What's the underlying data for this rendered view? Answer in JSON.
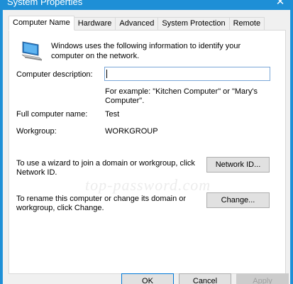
{
  "window": {
    "title": "System Properties",
    "close_glyph": "✕"
  },
  "tabs": [
    {
      "label": "Computer Name",
      "active": true
    },
    {
      "label": "Hardware",
      "active": false
    },
    {
      "label": "Advanced",
      "active": false
    },
    {
      "label": "System Protection",
      "active": false
    },
    {
      "label": "Remote",
      "active": false
    }
  ],
  "panel": {
    "intro": "Windows uses the following information to identify your computer on the network.",
    "computer_description": {
      "label": "Computer description:",
      "value": "",
      "example": "For example: \"Kitchen Computer\" or \"Mary's Computer\"."
    },
    "full_computer_name": {
      "label": "Full computer name:",
      "value": "Test"
    },
    "workgroup": {
      "label": "Workgroup:",
      "value": "WORKGROUP"
    },
    "network_id": {
      "text": "To use a wizard to join a domain or workgroup, click Network ID.",
      "button": "Network ID..."
    },
    "rename": {
      "text": "To rename this computer or change its domain or workgroup, click Change.",
      "button": "Change..."
    },
    "watermark": "top-password.com"
  },
  "footer": {
    "ok": "OK",
    "cancel": "Cancel",
    "apply": "Apply"
  },
  "colors": {
    "titlebar": "#1e8fd6",
    "dialog_bg": "#f0f0f0",
    "panel_bg": "#ffffff",
    "button_bg": "#e1e1e1"
  }
}
